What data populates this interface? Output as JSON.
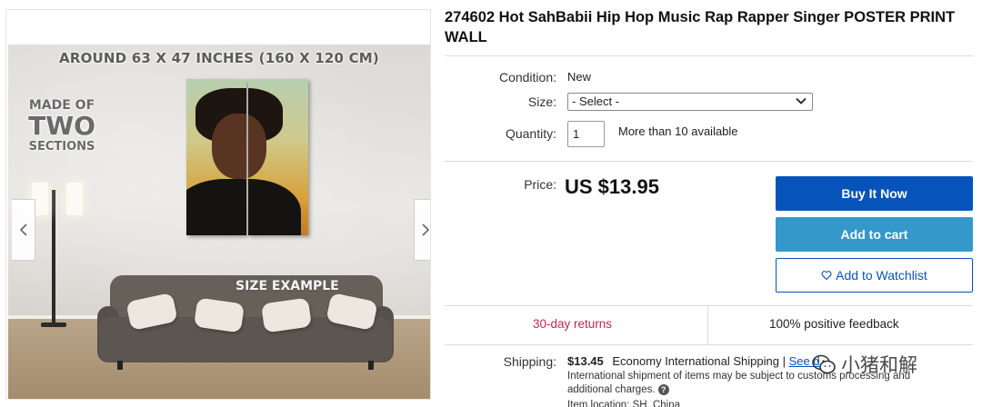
{
  "gallery": {
    "overlay_title": "AROUND 63 X 47 INCHES (160 X 120 CM)",
    "made_of_line1": "MADE OF",
    "made_of_line2": "TWO",
    "made_of_line3": "SECTIONS",
    "size_example": "SIZE EXAMPLE",
    "prev_icon": "chevron-left-icon",
    "next_icon": "chevron-right-icon"
  },
  "listing": {
    "title": "274602 Hot SahBabii Hip Hop Music Rap Rapper Singer POSTER PRINT WALL",
    "condition_label": "Condition:",
    "condition_value": "New",
    "size_label": "Size:",
    "size_selected": "- Select -",
    "quantity_label": "Quantity:",
    "quantity_value": "1",
    "availability": "More than 10 available",
    "price_label": "Price:",
    "price_value": "US $13.95"
  },
  "actions": {
    "buy_now": "Buy It Now",
    "add_to_cart": "Add to cart",
    "watchlist": "Add to Watchlist",
    "buy_color": "#0654ba",
    "cart_color": "#3498ca"
  },
  "trust": {
    "returns": "30-day returns",
    "feedback": "100% positive feedback"
  },
  "shipping": {
    "label": "Shipping:",
    "price": "$13.45",
    "method": "Economy International Shipping |",
    "details_link": "See d",
    "note": "International shipment of items may be subject to customs processing and additional charges.",
    "location_text": "Item location: SH, China"
  },
  "watermark": {
    "text": "小猪和解",
    "icon": "wechat-icon"
  }
}
